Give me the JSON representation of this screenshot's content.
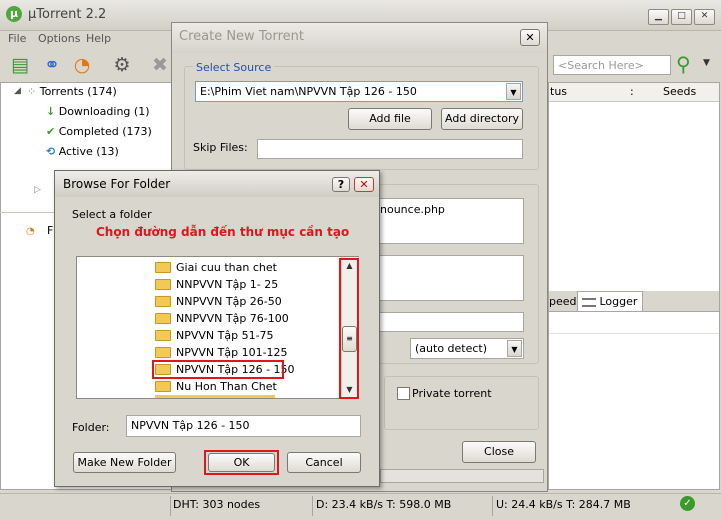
{
  "app": {
    "title": "µTorrent 2.2",
    "icon_letter": "µ"
  },
  "menu": [
    "File",
    "Options",
    "Help"
  ],
  "search": {
    "placeholder": "<Search Here>"
  },
  "tree": [
    {
      "label": "Torrents (174)",
      "icon": "torrents-icon"
    },
    {
      "label": "Downloading (1)",
      "icon": "download-arrow-icon"
    },
    {
      "label": "Completed (173)",
      "icon": "checkmark-icon"
    },
    {
      "label": "Active (13)",
      "icon": "refresh-icon"
    }
  ],
  "tree_feeds_label": "F",
  "columns": {
    "status": "tus",
    "seeds": "Seeds"
  },
  "tabs": {
    "speed": "peed",
    "logger": "Logger"
  },
  "status": {
    "dht": "DHT: 303 nodes",
    "down": "D: 23.4 kB/s T: 598.0 MB",
    "up": "U: 24.4 kB/s T: 284.7 MB"
  },
  "create_torrent": {
    "title": "Create New Torrent",
    "select_source": "Select Source",
    "source_path": "E:\\Phim Viet nam\\NPVVN Tập 126 - 150",
    "add_file": "Add file",
    "add_directory": "Add directory",
    "skip_files": "Skip Files:",
    "tracker_fragment": "nounce.php",
    "piece_size": "(auto detect)",
    "private_torrent": "Private torrent",
    "close": "Close"
  },
  "browse": {
    "title": "Browse For Folder",
    "help": "?",
    "close": "✕",
    "select_label": "Select a folder",
    "annotation": "Chọn đường dẫn đến thư mục cần tạo",
    "folders": [
      "Giai cuu than chet",
      "NNPVVN Tập 1- 25",
      "NNPVVN Tập 26-50",
      "NNPVVN Tập 76-100",
      "NPVVN Tập 51-75",
      "NPVVN Tập 101-125",
      "NPVVN Tập 126 - 150",
      "Nu Hon Than Chet"
    ],
    "selected_index": 6,
    "folder_label": "Folder:",
    "folder_value": "NPVVN Tập 126 - 150",
    "make_new_folder": "Make New Folder",
    "ok": "OK",
    "cancel": "Cancel"
  },
  "colors": {
    "highlight_red": "#e0161d",
    "folder_yellow": "#f2c955",
    "accent_green": "#3a9a2a"
  }
}
